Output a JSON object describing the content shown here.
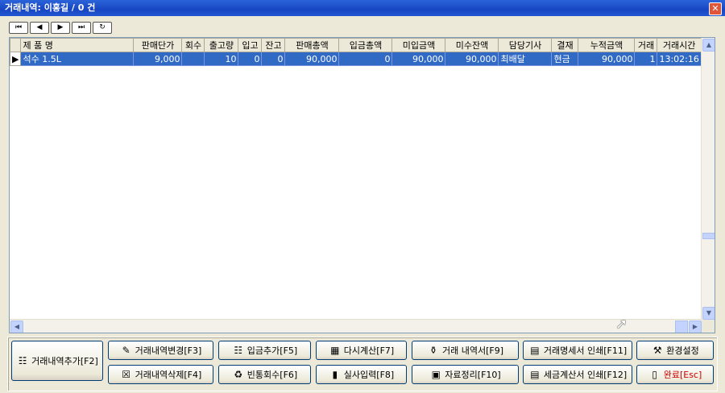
{
  "window": {
    "title": "거래내역: 이홍길 / 0 건",
    "close_icon": "✕"
  },
  "nav_buttons": [
    "⏮",
    "◀",
    "▶",
    "⏭",
    "↻"
  ],
  "grid": {
    "columns": [
      "제  품  명",
      "판매단가",
      "회수",
      "출고량",
      "입고",
      "잔고",
      "판매총액",
      "입금총액",
      "미입금액",
      "미수잔액",
      "담당기사",
      "결재",
      "누적금액",
      "거래",
      "거래시간"
    ],
    "rows": [
      [
        "석수 1.5L",
        "9,000",
        "",
        "10",
        "0",
        "0",
        "90,000",
        "0",
        "90,000",
        "90,000",
        "최배달",
        "현금",
        "90,000",
        "1",
        "13:02:16"
      ]
    ]
  },
  "buttons": {
    "add": "거래내역추가[F2]",
    "edit": "거래내역변경[F3]",
    "delete": "거래내역삭제[F4]",
    "deposit": "입금추가[F5]",
    "empty_return": "빈통회수[F6]",
    "recalc": "다시계산[F7]",
    "actual_input": "실사입력[F8]",
    "statement": "거래 내역서[F9]",
    "arrange": "자료정리[F10]",
    "print_statement": "거래명세서 인쇄[F11]",
    "print_invoice": "세금계산서 인쇄[F12]",
    "settings": "환경설정",
    "done": "완료[Esc]"
  }
}
